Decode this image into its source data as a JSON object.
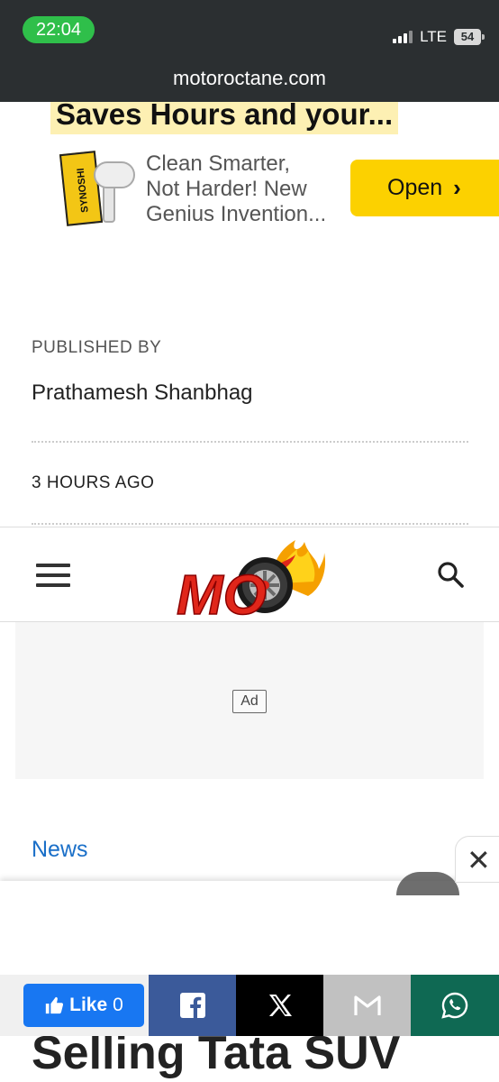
{
  "status_bar": {
    "time": "22:04",
    "network": "LTE",
    "battery": "54"
  },
  "browser": {
    "url": "motoroctane.com"
  },
  "ad_banner": {
    "headline": "Saves Hours and your...",
    "product_label": "SYNOSHI",
    "text_lines": [
      "Clean Smarter,",
      "Not Harder! New",
      "Genius Invention..."
    ],
    "open_button": "Open",
    "open_button_color": "#fcd100"
  },
  "article_meta": {
    "published_by_label": "PUBLISHED BY",
    "author": "Prathamesh Shanbhag",
    "time_ago": "3 HOURS AGO"
  },
  "site_nav": {
    "menu_icon": "hamburger-icon",
    "logo_text": "MO",
    "search_icon": "search-icon"
  },
  "ad_slot": {
    "tag": "Ad"
  },
  "category": {
    "label": "News",
    "color": "#1a6fc8"
  },
  "article": {
    "title_partial": "Selling Tata SUV"
  },
  "share_bar": {
    "like_label": "Like",
    "like_count": "0",
    "buttons": [
      {
        "name": "facebook",
        "color": "#3b5a9a"
      },
      {
        "name": "x",
        "color": "#000000"
      },
      {
        "name": "gmail",
        "color": "#c1c1c1"
      },
      {
        "name": "whatsapp",
        "color": "#0f6953"
      }
    ]
  }
}
